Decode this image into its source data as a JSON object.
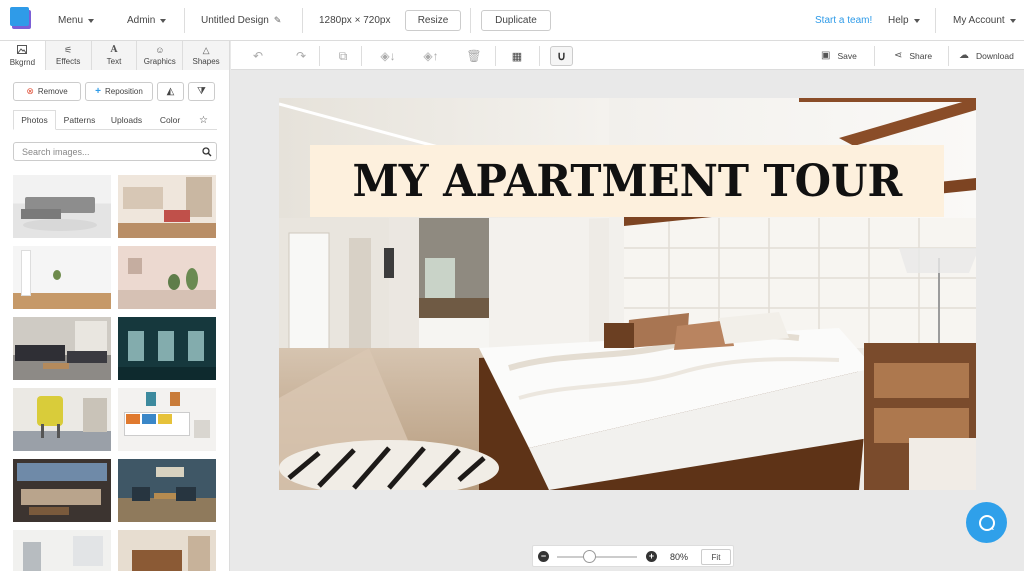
{
  "topbar": {
    "menu": "Menu",
    "admin": "Admin",
    "design_name": "Untitled Design",
    "dimensions": "1280px × 720px",
    "resize": "Resize",
    "duplicate": "Duplicate",
    "start_team": "Start a team!",
    "help": "Help",
    "account": "My Account",
    "accent_color": "#2f9be8"
  },
  "sidebar": {
    "tabs": [
      {
        "label": "Bkgrnd",
        "icon": "image-icon"
      },
      {
        "label": "Effects",
        "icon": "wand-icon"
      },
      {
        "label": "Text",
        "icon": "text-icon"
      },
      {
        "label": "Graphics",
        "icon": "smiley-icon"
      },
      {
        "label": "Shapes",
        "icon": "triangle-icon"
      }
    ],
    "actions": {
      "remove": "Remove",
      "reposition": "Reposition"
    },
    "subtabs": [
      "Photos",
      "Patterns",
      "Uploads",
      "Color"
    ],
    "search_placeholder": "Search images..."
  },
  "toolbar": {
    "save": "Save",
    "share": "Share",
    "download": "Download"
  },
  "canvas": {
    "title": "MY APARTMENT TOUR",
    "title_bg": "#fdf0dd"
  },
  "zoom": {
    "value": "80%",
    "fit": "Fit",
    "level": 0.4
  }
}
